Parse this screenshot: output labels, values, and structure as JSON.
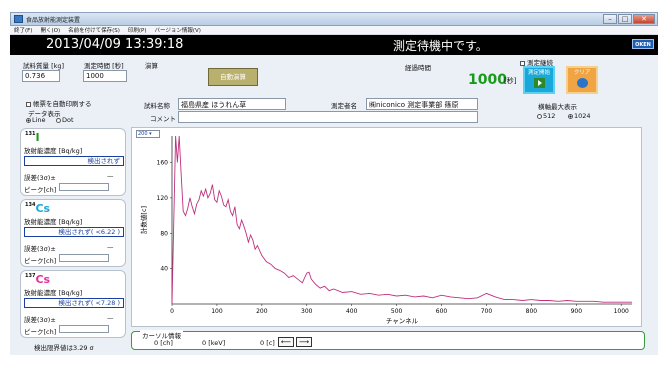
{
  "window": {
    "title": "食品放射能測定装置"
  },
  "menu": [
    "終了(F)",
    "開く(O)",
    "名前を付けて保存(S)",
    "印刷(P)",
    "バージョン情報(V)"
  ],
  "header": {
    "datetime": "2013/04/09 13:39:18",
    "status": "測定待機中です。",
    "logo": "OKEN"
  },
  "inputs": {
    "weight_label": "試料質量 [kg]",
    "weight_value": "0.736",
    "time_label": "測定時間 [秒]",
    "time_value": "1000",
    "calc_label": "演算",
    "auto_calc_label": "自動演算",
    "elapsed_label": "経過時間",
    "elapsed_value": "1000",
    "elapsed_unit": "[秒]",
    "continuous_label": "測定継続",
    "start_label": "測定開始",
    "clear_label": "クリア"
  },
  "options": {
    "auto_print_label": "帳票を自動印刷する",
    "data_display_label": "データ表示",
    "line_label": "Line",
    "dot_label": "Dot",
    "axis_max_label": "横軸最大表示",
    "axis_512": "512",
    "axis_1024": "1024"
  },
  "sample": {
    "name_label": "試料名称",
    "name_value": "福島県産 ほうれん草",
    "operator_label": "測定者名",
    "operator_value": "㈱niconico 測定事業部 篠原",
    "comment_label": "コメント",
    "comment_value": ""
  },
  "isotopes": [
    {
      "mass": "131",
      "element": "I",
      "color": "#1a9a1a",
      "conc_label": "放射能濃度 [Bq/kg]",
      "result": "検出されず",
      "error_label": "誤差(3σ)±",
      "error_value": "—",
      "peak_label": "ピーク[ch]",
      "peak_value": ""
    },
    {
      "mass": "134",
      "element": "Cs",
      "color": "#1aa8d8",
      "conc_label": "放射能濃度 [Bq/kg]",
      "result": "検出されず( <6.22 )",
      "error_label": "誤差(3σ)±",
      "error_value": "—",
      "peak_label": "ピーク[ch]",
      "peak_value": ""
    },
    {
      "mass": "137",
      "element": "Cs",
      "color": "#e0309a",
      "conc_label": "放射能濃度 [Bq/kg]",
      "result": "検出されず( <7.28 )",
      "error_label": "誤差(3σ)±",
      "error_value": "—",
      "peak_label": "ピーク[ch]",
      "peak_value": ""
    }
  ],
  "detection_limit": "検出限界値は3.29 σ",
  "scale_select": "200",
  "cursor": {
    "label": "カーソル情報",
    "ch": "0 [ch]",
    "kev": "0 [keV]",
    "count": "0 [c]"
  },
  "chart_data": {
    "type": "line",
    "xlabel": "チャンネル",
    "ylabel": "計数値[c]",
    "xlim": [
      0,
      1024
    ],
    "ylim": [
      0,
      190
    ],
    "xticks": [
      0,
      100,
      200,
      300,
      400,
      500,
      600,
      700,
      800,
      900,
      1000
    ],
    "yticks": [
      40,
      80,
      120,
      160
    ],
    "line_color": "#c0307f",
    "series": [
      {
        "x": [
          0,
          8,
          12,
          16,
          20,
          25,
          30,
          35,
          40,
          45,
          50,
          55,
          60,
          65,
          70,
          75,
          80,
          85,
          90,
          95,
          100,
          105,
          110,
          115,
          120,
          125,
          130,
          135,
          140,
          145,
          150,
          155,
          160,
          165,
          170,
          175,
          180,
          185,
          190,
          200,
          210,
          220,
          230,
          240,
          250,
          260,
          270,
          280,
          290,
          300,
          305,
          310,
          320,
          330,
          340,
          350,
          360,
          380,
          400,
          420,
          440,
          460,
          480,
          500,
          520,
          540,
          560,
          580,
          600,
          620,
          640,
          660,
          680,
          700,
          720,
          740,
          760,
          780,
          800,
          820,
          840,
          860,
          880,
          900,
          920,
          940,
          960,
          980,
          1000,
          1024
        ],
        "y": [
          0,
          190,
          160,
          190,
          150,
          105,
          100,
          108,
          120,
          110,
          102,
          113,
          118,
          128,
          122,
          130,
          120,
          125,
          135,
          118,
          115,
          128,
          122,
          112,
          110,
          118,
          105,
          100,
          110,
          90,
          85,
          95,
          88,
          80,
          70,
          78,
          72,
          62,
          66,
          55,
          48,
          45,
          40,
          38,
          35,
          30,
          32,
          28,
          24,
          35,
          36,
          28,
          22,
          18,
          20,
          15,
          17,
          13,
          14,
          11,
          12,
          10,
          11,
          9,
          10,
          8,
          9,
          7,
          10,
          8,
          7,
          6,
          7,
          12,
          8,
          5,
          5,
          4,
          5,
          4,
          4,
          3,
          4,
          3,
          3,
          3,
          2,
          2,
          2,
          2
        ]
      }
    ]
  }
}
